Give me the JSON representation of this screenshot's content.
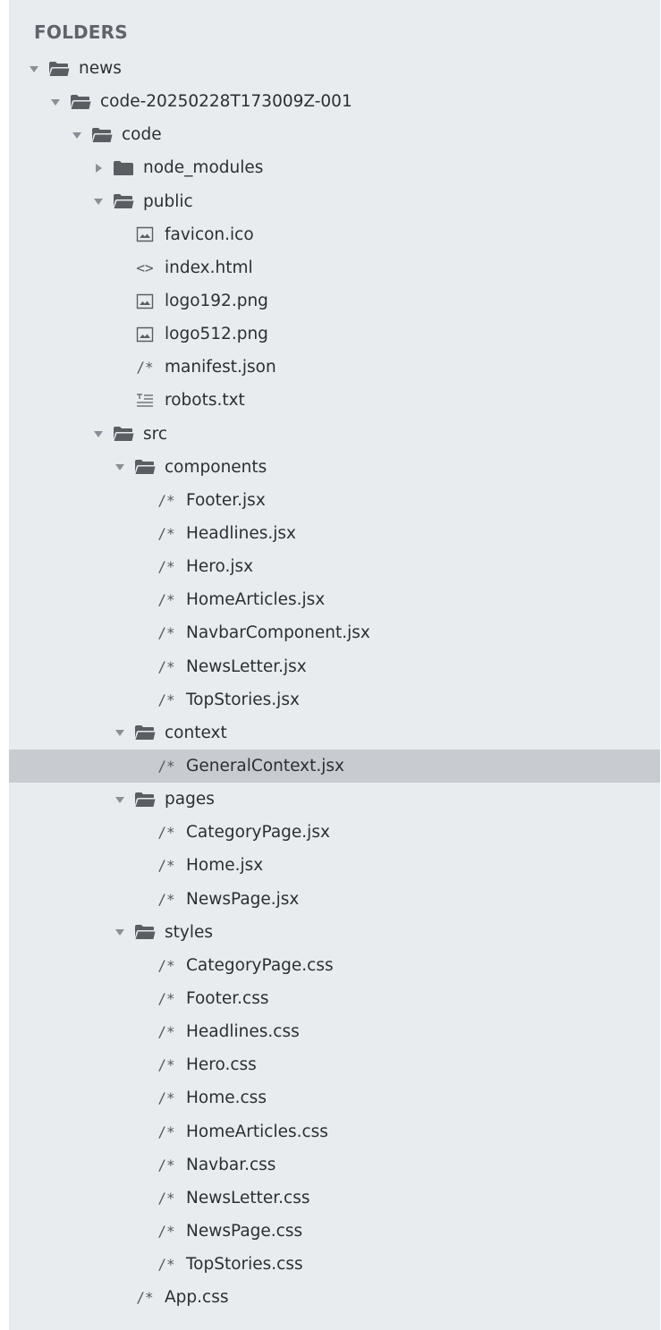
{
  "sidebar": {
    "header": "FOLDERS",
    "tree": [
      {
        "label": "news",
        "kind": "folder",
        "depth": 0,
        "expanded": true,
        "icon": "folder-open-icon"
      },
      {
        "label": "code-20250228T173009Z-001",
        "kind": "folder",
        "depth": 1,
        "expanded": true,
        "icon": "folder-open-icon"
      },
      {
        "label": "code",
        "kind": "folder",
        "depth": 2,
        "expanded": true,
        "icon": "folder-open-icon"
      },
      {
        "label": "node_modules",
        "kind": "folder",
        "depth": 3,
        "expanded": false,
        "icon": "folder-closed-icon"
      },
      {
        "label": "public",
        "kind": "folder",
        "depth": 3,
        "expanded": true,
        "icon": "folder-open-icon"
      },
      {
        "label": "favicon.ico",
        "kind": "file",
        "depth": 4,
        "icon": "image-file-icon"
      },
      {
        "label": "index.html",
        "kind": "file",
        "depth": 4,
        "icon": "code-file-icon",
        "glyph": "<>"
      },
      {
        "label": "logo192.png",
        "kind": "file",
        "depth": 4,
        "icon": "image-file-icon"
      },
      {
        "label": "logo512.png",
        "kind": "file",
        "depth": 4,
        "icon": "image-file-icon"
      },
      {
        "label": "manifest.json",
        "kind": "file",
        "depth": 4,
        "icon": "comment-file-icon",
        "glyph": "/*"
      },
      {
        "label": "robots.txt",
        "kind": "file",
        "depth": 4,
        "icon": "text-file-icon"
      },
      {
        "label": "src",
        "kind": "folder",
        "depth": 3,
        "expanded": true,
        "icon": "folder-open-icon"
      },
      {
        "label": "components",
        "kind": "folder",
        "depth": 4,
        "expanded": true,
        "icon": "folder-open-icon"
      },
      {
        "label": "Footer.jsx",
        "kind": "file",
        "depth": 5,
        "icon": "comment-file-icon",
        "glyph": "/*"
      },
      {
        "label": "Headlines.jsx",
        "kind": "file",
        "depth": 5,
        "icon": "comment-file-icon",
        "glyph": "/*"
      },
      {
        "label": "Hero.jsx",
        "kind": "file",
        "depth": 5,
        "icon": "comment-file-icon",
        "glyph": "/*"
      },
      {
        "label": "HomeArticles.jsx",
        "kind": "file",
        "depth": 5,
        "icon": "comment-file-icon",
        "glyph": "/*"
      },
      {
        "label": "NavbarComponent.jsx",
        "kind": "file",
        "depth": 5,
        "icon": "comment-file-icon",
        "glyph": "/*"
      },
      {
        "label": "NewsLetter.jsx",
        "kind": "file",
        "depth": 5,
        "icon": "comment-file-icon",
        "glyph": "/*"
      },
      {
        "label": "TopStories.jsx",
        "kind": "file",
        "depth": 5,
        "icon": "comment-file-icon",
        "glyph": "/*"
      },
      {
        "label": "context",
        "kind": "folder",
        "depth": 4,
        "expanded": true,
        "icon": "folder-open-icon"
      },
      {
        "label": "GeneralContext.jsx",
        "kind": "file",
        "depth": 5,
        "icon": "comment-file-icon",
        "glyph": "/*",
        "selected": true
      },
      {
        "label": "pages",
        "kind": "folder",
        "depth": 4,
        "expanded": true,
        "icon": "folder-open-icon"
      },
      {
        "label": "CategoryPage.jsx",
        "kind": "file",
        "depth": 5,
        "icon": "comment-file-icon",
        "glyph": "/*"
      },
      {
        "label": "Home.jsx",
        "kind": "file",
        "depth": 5,
        "icon": "comment-file-icon",
        "glyph": "/*"
      },
      {
        "label": "NewsPage.jsx",
        "kind": "file",
        "depth": 5,
        "icon": "comment-file-icon",
        "glyph": "/*"
      },
      {
        "label": "styles",
        "kind": "folder",
        "depth": 4,
        "expanded": true,
        "icon": "folder-open-icon"
      },
      {
        "label": "CategoryPage.css",
        "kind": "file",
        "depth": 5,
        "icon": "comment-file-icon",
        "glyph": "/*"
      },
      {
        "label": "Footer.css",
        "kind": "file",
        "depth": 5,
        "icon": "comment-file-icon",
        "glyph": "/*"
      },
      {
        "label": "Headlines.css",
        "kind": "file",
        "depth": 5,
        "icon": "comment-file-icon",
        "glyph": "/*"
      },
      {
        "label": "Hero.css",
        "kind": "file",
        "depth": 5,
        "icon": "comment-file-icon",
        "glyph": "/*"
      },
      {
        "label": "Home.css",
        "kind": "file",
        "depth": 5,
        "icon": "comment-file-icon",
        "glyph": "/*"
      },
      {
        "label": "HomeArticles.css",
        "kind": "file",
        "depth": 5,
        "icon": "comment-file-icon",
        "glyph": "/*"
      },
      {
        "label": "Navbar.css",
        "kind": "file",
        "depth": 5,
        "icon": "comment-file-icon",
        "glyph": "/*"
      },
      {
        "label": "NewsLetter.css",
        "kind": "file",
        "depth": 5,
        "icon": "comment-file-icon",
        "glyph": "/*"
      },
      {
        "label": "NewsPage.css",
        "kind": "file",
        "depth": 5,
        "icon": "comment-file-icon",
        "glyph": "/*"
      },
      {
        "label": "TopStories.css",
        "kind": "file",
        "depth": 5,
        "icon": "comment-file-icon",
        "glyph": "/*"
      },
      {
        "label": "App.css",
        "kind": "file",
        "depth": 4,
        "icon": "comment-file-icon",
        "glyph": "/*"
      }
    ]
  },
  "colors": {
    "panel_background": "#e9ecef",
    "selected_row": "#c8ccd1",
    "label_text": "#2b2f33",
    "header_text": "#5f646b",
    "icon": "#5a5e63"
  }
}
